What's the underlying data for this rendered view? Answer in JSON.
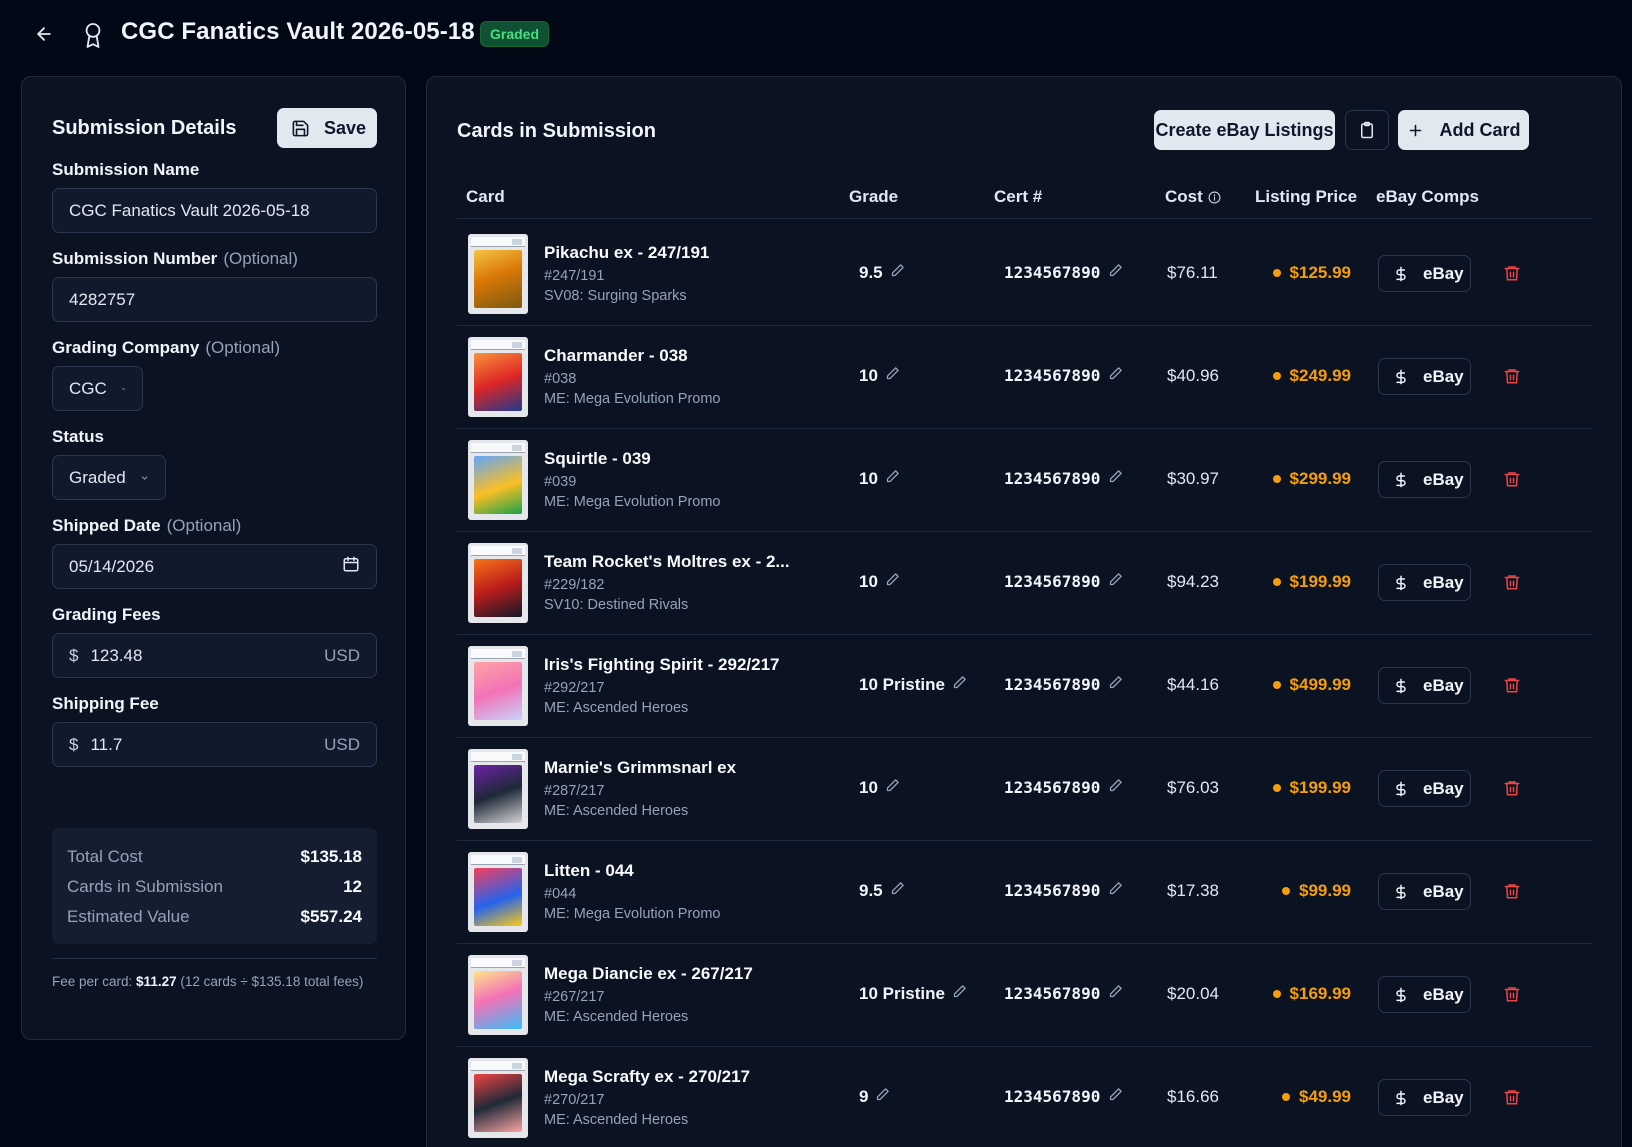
{
  "header": {
    "title": "CGC Fanatics Vault 2026-05-18",
    "status_badge": "Graded"
  },
  "details": {
    "title": "Submission Details",
    "save_label": "Save",
    "submission_name_label": "Submission Name",
    "submission_name_value": "CGC Fanatics Vault 2026-05-18",
    "submission_number_label": "Submission Number",
    "optional_label": "(Optional)",
    "submission_number_value": "4282757",
    "grading_company_label": "Grading Company",
    "grading_company_value": "CGC",
    "status_label": "Status",
    "status_value": "Graded",
    "shipped_date_label": "Shipped Date",
    "shipped_date_value": "05/14/2026",
    "grading_fees_label": "Grading Fees",
    "grading_fees_value": "123.48",
    "shipping_fee_label": "Shipping Fee",
    "shipping_fee_value": "11.7",
    "currency_symbol": "$",
    "currency_code": "USD",
    "summary": {
      "total_cost_label": "Total Cost",
      "total_cost_value": "$135.18",
      "cards_label": "Cards in Submission",
      "cards_value": "12",
      "estimated_label": "Estimated Value",
      "estimated_value": "$557.24"
    },
    "fee_note": {
      "prefix": "Fee per card: ",
      "amount": "$11.27",
      "suffix": " (12 cards ÷ $135.18 total fees)"
    }
  },
  "cards_panel": {
    "title": "Cards in Submission",
    "create_listings_label": "Create eBay Listings",
    "add_card_label": "Add Card",
    "columns": {
      "card": "Card",
      "grade": "Grade",
      "cert": "Cert #",
      "cost": "Cost",
      "listing_price": "Listing Price",
      "ebay_comps": "eBay Comps"
    },
    "ebay_label": "eBay",
    "rows": [
      {
        "name": "Pikachu ex - 247/191",
        "number": "#247/191",
        "set": "SV08: Surging Sparks",
        "grade": "9.5",
        "cert": "1234567890",
        "cost": "$76.11",
        "price": "$125.99"
      },
      {
        "name": "Charmander - 038",
        "number": "#038",
        "set": "ME: Mega Evolution Promo",
        "grade": "10",
        "cert": "1234567890",
        "cost": "$40.96",
        "price": "$249.99"
      },
      {
        "name": "Squirtle - 039",
        "number": "#039",
        "set": "ME: Mega Evolution Promo",
        "grade": "10",
        "cert": "1234567890",
        "cost": "$30.97",
        "price": "$299.99"
      },
      {
        "name": "Team Rocket's Moltres ex - 2...",
        "number": "#229/182",
        "set": "SV10: Destined Rivals",
        "grade": "10",
        "cert": "1234567890",
        "cost": "$94.23",
        "price": "$199.99"
      },
      {
        "name": "Iris's Fighting Spirit - 292/217",
        "number": "#292/217",
        "set": "ME: Ascended Heroes",
        "grade": "10 Pristine",
        "cert": "1234567890",
        "cost": "$44.16",
        "price": "$499.99"
      },
      {
        "name": "Marnie's Grimmsnarl ex",
        "number": "#287/217",
        "set": "ME: Ascended Heroes",
        "grade": "10",
        "cert": "1234567890",
        "cost": "$76.03",
        "price": "$199.99"
      },
      {
        "name": "Litten - 044",
        "number": "#044",
        "set": "ME: Mega Evolution Promo",
        "grade": "9.5",
        "cert": "1234567890",
        "cost": "$17.38",
        "price": "$99.99"
      },
      {
        "name": "Mega Diancie ex - 267/217",
        "number": "#267/217",
        "set": "ME: Ascended Heroes",
        "grade": "10 Pristine",
        "cert": "1234567890",
        "cost": "$20.04",
        "price": "$169.99"
      },
      {
        "name": "Mega Scrafty ex - 270/217",
        "number": "#270/217",
        "set": "ME: Ascended Heroes",
        "grade": "9",
        "cert": "1234567890",
        "cost": "$16.66",
        "price": "$49.99"
      }
    ]
  },
  "colors": {
    "background": "#030817",
    "panel": "#0b1222",
    "accent_price": "#f59e0b",
    "badge_green": "#4ade80",
    "delete_red": "#ef4444"
  },
  "icons": {
    "back": "arrow-left-icon",
    "title": "award-icon",
    "save": "floppy-disk-icon",
    "clipboard": "clipboard-icon",
    "add": "plus-icon",
    "info": "info-icon",
    "calendar": "calendar-icon",
    "chevron": "chevron-down-icon",
    "edit": "pencil-icon",
    "ebay": "dollar-icon",
    "delete": "trash-icon"
  }
}
